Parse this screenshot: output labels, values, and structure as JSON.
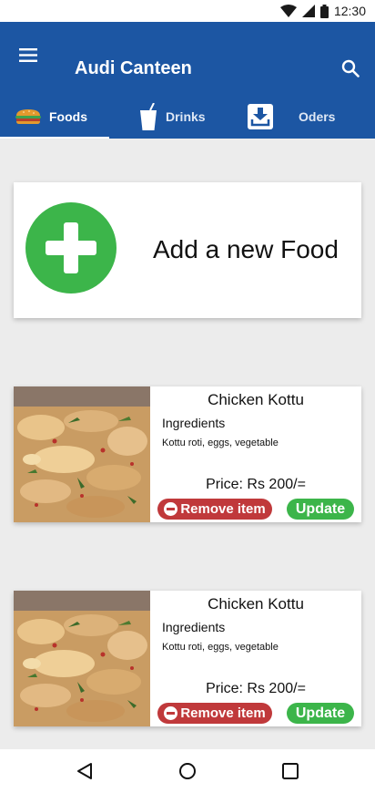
{
  "status_bar": {
    "time": "12:30"
  },
  "app_bar": {
    "title": "Audi Canteen"
  },
  "tabs": [
    {
      "label": "Foods",
      "icon": "burger-icon",
      "selected": true
    },
    {
      "label": "Drinks",
      "icon": "drink-cup-icon",
      "selected": false
    },
    {
      "label": "Oders",
      "icon": "inbox-download-icon",
      "selected": false
    }
  ],
  "add_card": {
    "label": "Add a new Food",
    "icon": "plus-icon"
  },
  "food_items": [
    {
      "name": "Chicken Kottu",
      "ingredients_heading": "Ingredients",
      "ingredients": "Kottu roti, eggs, vegetable",
      "price": "Price: Rs 200/=",
      "remove_label": "Remove item",
      "update_label": "Update"
    },
    {
      "name": "Chicken Kottu",
      "ingredients_heading": "Ingredients",
      "ingredients": "Kottu roti, eggs, vegetable",
      "price": "Price: Rs 200/=",
      "remove_label": "Remove item",
      "update_label": "Update"
    }
  ],
  "colors": {
    "primary": "#1c56a3",
    "accent_green": "#3cb54a",
    "danger_red": "#c0393b",
    "background": "#ececec"
  }
}
